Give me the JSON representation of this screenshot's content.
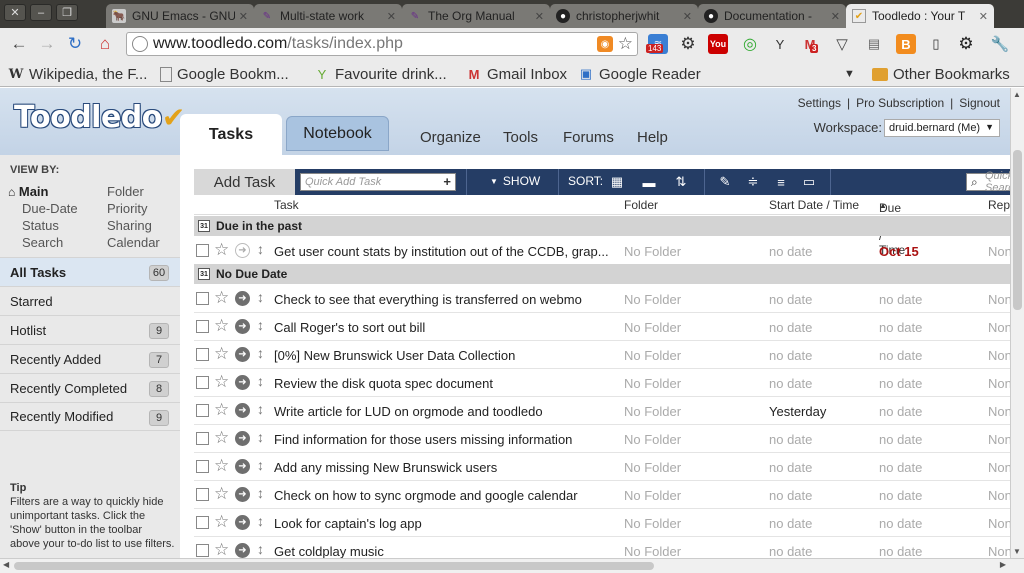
{
  "browser": {
    "window_controls": [
      "✕",
      "–",
      "❐"
    ],
    "tabs": [
      {
        "title": "GNU Emacs - GNU",
        "favicon": "gnu-icon"
      },
      {
        "title": "Multi-state work",
        "favicon": "emacs-icon"
      },
      {
        "title": "The Org Manual",
        "favicon": "emacs-icon"
      },
      {
        "title": "christopherjwhit",
        "favicon": "github-icon"
      },
      {
        "title": "Documentation -",
        "favicon": "github-icon"
      },
      {
        "title": "Toodledo : Your T",
        "favicon": "toodledo-icon",
        "active": true
      }
    ],
    "url_host": "www.toodledo.com",
    "url_path": "/tasks/index.php",
    "badges": {
      "rss_reader": "143",
      "gmail": "3"
    },
    "bookmarks": [
      {
        "label": "Wikipedia, the F...",
        "icon": "wikipedia-icon"
      },
      {
        "label": "Google Bookm...",
        "icon": "page-icon"
      },
      {
        "label": "Favourite drink...",
        "icon": "cocktail-icon"
      },
      {
        "label": "Gmail Inbox",
        "icon": "gmail-icon"
      },
      {
        "label": "Google Reader",
        "icon": "reader-icon"
      }
    ],
    "other_bookmarks": "Other Bookmarks"
  },
  "header": {
    "logo": "Toodledo",
    "tabs": {
      "tasks": "Tasks",
      "notebook": "Notebook"
    },
    "nav": [
      "Organize",
      "Tools",
      "Forums",
      "Help"
    ],
    "account_links": [
      "Settings",
      "Pro Subscription",
      "Signout"
    ],
    "workspace_label": "Workspace:",
    "workspace_value": "druid.bernard (Me)"
  },
  "sidebar": {
    "view_by_label": "VIEW BY:",
    "view_by_left": [
      "Main",
      "Due-Date",
      "Status",
      "Search"
    ],
    "view_by_right": [
      "Folder",
      "Priority",
      "Sharing",
      "Calendar"
    ],
    "items": [
      {
        "label": "All Tasks",
        "count": "60",
        "selected": true
      },
      {
        "label": "Starred",
        "count": ""
      },
      {
        "label": "Hotlist",
        "count": "9"
      },
      {
        "label": "Recently Added",
        "count": "7"
      },
      {
        "label": "Recently Completed",
        "count": "8"
      },
      {
        "label": "Recently Modified",
        "count": "9"
      }
    ],
    "tip_title": "Tip",
    "tip_text": "Filters are a way to quickly hide unimportant tasks. Click the 'Show' button in the toolbar above your to-do list to use filters."
  },
  "toolbar": {
    "add_task": "Add Task",
    "quick_add_placeholder": "Quick Add Task",
    "show": "SHOW",
    "sort": "SORT:",
    "search_placeholder": "Quick Search"
  },
  "columns": {
    "task": "Task",
    "folder": "Folder",
    "start": "Start Date / Time",
    "due": "Due Date / Time",
    "repeat": "Rep"
  },
  "groups": {
    "past": "Due in the past",
    "nodue": "No Due Date"
  },
  "tasks_past": [
    {
      "task": "Get user count stats by institution out of the CCDB, grap...",
      "folder": "No Folder",
      "start": "no date",
      "due": "Oct 15",
      "repeat": "None"
    }
  ],
  "tasks_nodue": [
    {
      "task": "Check to see that everything is transferred on webmo",
      "folder": "No Folder",
      "start": "no date",
      "due": "no date",
      "repeat": "None"
    },
    {
      "task": "Call Roger's to sort out bill",
      "folder": "No Folder",
      "start": "no date",
      "due": "no date",
      "repeat": "None"
    },
    {
      "task": "[0%] New Brunswick User Data Collection",
      "folder": "No Folder",
      "start": "no date",
      "due": "no date",
      "repeat": "None"
    },
    {
      "task": "Review the disk quota spec document",
      "folder": "No Folder",
      "start": "no date",
      "due": "no date",
      "repeat": "None"
    },
    {
      "task": "Write article for LUD on orgmode and toodledo",
      "folder": "No Folder",
      "start": "Yesterday",
      "due": "no date",
      "repeat": "None"
    },
    {
      "task": "Find information for those users missing information",
      "folder": "No Folder",
      "start": "no date",
      "due": "no date",
      "repeat": "None"
    },
    {
      "task": "Add any missing New Brunswick users",
      "folder": "No Folder",
      "start": "no date",
      "due": "no date",
      "repeat": "None"
    },
    {
      "task": "Check on how to sync orgmode and google calendar",
      "folder": "No Folder",
      "start": "no date",
      "due": "no date",
      "repeat": "None"
    },
    {
      "task": "Look for captain's log app",
      "folder": "No Folder",
      "start": "no date",
      "due": "no date",
      "repeat": "None"
    },
    {
      "task": "Get coldplay music",
      "folder": "No Folder",
      "start": "no date",
      "due": "no date",
      "repeat": "None"
    }
  ]
}
